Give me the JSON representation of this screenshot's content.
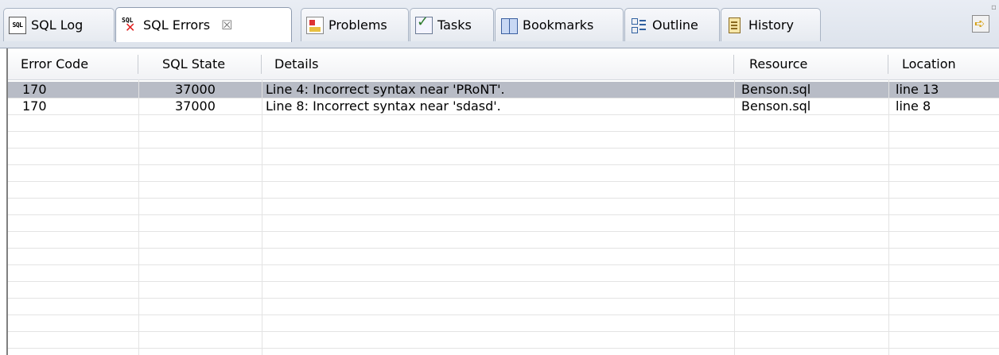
{
  "tabs": [
    {
      "label": "SQL Log",
      "icon": "sql-log-icon",
      "active": false
    },
    {
      "label": "SQL Errors",
      "icon": "sql-errors-icon",
      "active": true
    },
    {
      "label": "Problems",
      "icon": "problems-icon",
      "active": false
    },
    {
      "label": "Tasks",
      "icon": "tasks-icon",
      "active": false
    },
    {
      "label": "Bookmarks",
      "icon": "bookmarks-icon",
      "active": false
    },
    {
      "label": "Outline",
      "icon": "outline-icon",
      "active": false
    },
    {
      "label": "History",
      "icon": "history-icon",
      "active": false
    }
  ],
  "active_tab_close": "☒",
  "sql_icon_text": "SQL",
  "table": {
    "columns": [
      "Error Code",
      "SQL State",
      "Details",
      "Resource",
      "Location"
    ],
    "rows": [
      {
        "error_code": "170",
        "sql_state": "37000",
        "details": "Line 4: Incorrect syntax near 'PRoNT'.",
        "resource": "Benson.sql",
        "location": "line 13",
        "selected": true
      },
      {
        "error_code": "170",
        "sql_state": "37000",
        "details": "Line 8: Incorrect syntax near 'sdasd'.",
        "resource": "Benson.sql",
        "location": "line 8",
        "selected": false
      }
    ]
  },
  "colors": {
    "selection": "#b8bcc6",
    "tab_border": "#a9b4c4",
    "error_x": "#e02020"
  }
}
